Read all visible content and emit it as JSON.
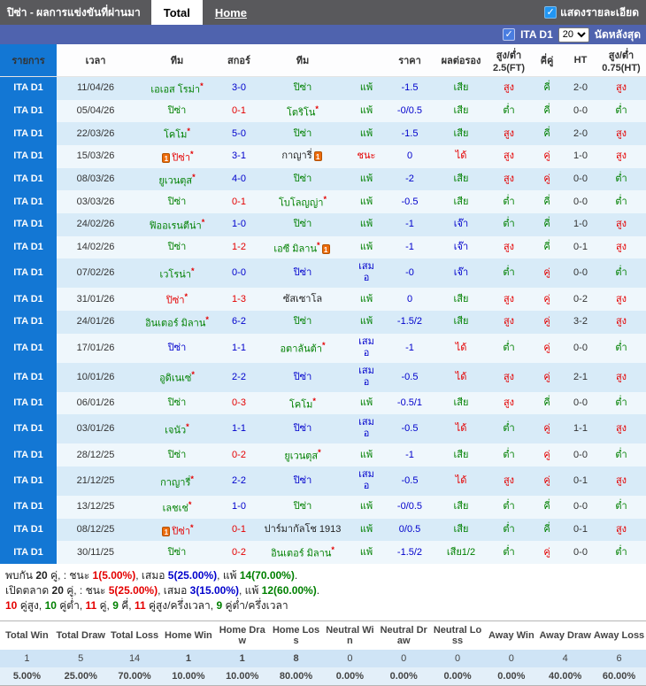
{
  "topbar": {
    "title": "ปิซ่า - ผลการแข่งขันที่ผ่านมา",
    "tabs": [
      {
        "label": "Total",
        "active": true
      },
      {
        "label": "Home",
        "active": false
      }
    ],
    "detail_checkbox_label": "แสดงรายละเอียด",
    "checkbox_checked": "✓"
  },
  "filterbar": {
    "league_label": "ITA D1",
    "match_count": "20",
    "suffix_label": "นัดหลังสุด",
    "checkbox_checked": "✓"
  },
  "colors": {
    "accent_blue_bar": "#4f63ae",
    "league_badge": "#1377d4",
    "row_odd": "#d8ebf8",
    "row_even": "#eff7fc",
    "win_red": "#e40000",
    "lose_green": "#008000",
    "draw_blue": "#0000cc"
  },
  "value_color_map": {
    "สูง": "red",
    "ต่ำ": "green",
    "คี่": "green",
    "คู่": "red",
    "แพ้": "green",
    "ชนะ": "red",
    "เสมอ": "blue",
    "เสีย": "green",
    "เสีย1/2": "green",
    "ได้": "red",
    "เจ๊า": "blue"
  },
  "table": {
    "headers": [
      "รายการ",
      "เวลา",
      "ทีม",
      "สกอร์",
      "ทีม",
      "",
      "ราคา",
      "ผลต่อรอง",
      "สูง/ต่ำ 2.5(FT)",
      "คี่คู่",
      "HT",
      "สูง/ต่ำ 0.75(HT)"
    ],
    "rows": [
      {
        "league": "ITA D1",
        "date": "11/04/26",
        "home": {
          "n": "เอเอส โรม่า",
          "c": "green",
          "s": 1
        },
        "score": "3-0",
        "sc": "blue",
        "away": {
          "n": "ปิซ่า",
          "c": "green"
        },
        "result": "แพ้",
        "price": "-1.5",
        "hdp": "เสีย",
        "ou_ft": "สูง",
        "oe": "คี่",
        "ht": "2-0",
        "ou_ht": "สูง"
      },
      {
        "league": "ITA D1",
        "date": "05/04/26",
        "home": {
          "n": "ปิซ่า",
          "c": "green"
        },
        "score": "0-1",
        "sc": "red",
        "away": {
          "n": "โตริโน",
          "c": "green",
          "s": 1
        },
        "result": "แพ้",
        "price": "-0/0.5",
        "hdp": "เสีย",
        "ou_ft": "ต่ำ",
        "oe": "คี่",
        "ht": "0-0",
        "ou_ht": "ต่ำ"
      },
      {
        "league": "ITA D1",
        "date": "22/03/26",
        "home": {
          "n": "โคโม",
          "c": "green",
          "s": 1
        },
        "score": "5-0",
        "sc": "blue",
        "away": {
          "n": "ปิซ่า",
          "c": "green"
        },
        "result": "แพ้",
        "price": "-1.5",
        "hdp": "เสีย",
        "ou_ft": "สูง",
        "oe": "คี่",
        "ht": "2-0",
        "ou_ht": "สูง"
      },
      {
        "league": "ITA D1",
        "date": "15/03/26",
        "home": {
          "n": "ปิซ่า",
          "c": "red",
          "s": 1,
          "cd": 1
        },
        "score": "3-1",
        "sc": "blue",
        "away": {
          "n": "กาญารี่",
          "c": "black",
          "cd": 1
        },
        "result": "ชนะ",
        "price": "0",
        "hdp": "ได้",
        "ou_ft": "สูง",
        "oe": "คู่",
        "ht": "1-0",
        "ou_ht": "สูง"
      },
      {
        "league": "ITA D1",
        "date": "08/03/26",
        "home": {
          "n": "ยูเวนตุส",
          "c": "green",
          "s": 1
        },
        "score": "4-0",
        "sc": "blue",
        "away": {
          "n": "ปิซ่า",
          "c": "green"
        },
        "result": "แพ้",
        "price": "-2",
        "hdp": "เสีย",
        "ou_ft": "สูง",
        "oe": "คู่",
        "ht": "0-0",
        "ou_ht": "ต่ำ"
      },
      {
        "league": "ITA D1",
        "date": "03/03/26",
        "home": {
          "n": "ปิซ่า",
          "c": "green"
        },
        "score": "0-1",
        "sc": "red",
        "away": {
          "n": "โบโลญญ่า",
          "c": "green",
          "s": 1
        },
        "result": "แพ้",
        "price": "-0.5",
        "hdp": "เสีย",
        "ou_ft": "ต่ำ",
        "oe": "คี่",
        "ht": "0-0",
        "ou_ht": "ต่ำ"
      },
      {
        "league": "ITA D1",
        "date": "24/02/26",
        "home": {
          "n": "ฟิออเรนตีน่า",
          "c": "green",
          "s": 1
        },
        "score": "1-0",
        "sc": "blue",
        "away": {
          "n": "ปิซ่า",
          "c": "green"
        },
        "result": "แพ้",
        "price": "-1",
        "hdp": "เจ๊า",
        "ou_ft": "ต่ำ",
        "oe": "คี่",
        "ht": "1-0",
        "ou_ht": "สูง"
      },
      {
        "league": "ITA D1",
        "date": "14/02/26",
        "home": {
          "n": "ปิซ่า",
          "c": "green"
        },
        "score": "1-2",
        "sc": "red",
        "away": {
          "n": "เอซี มิลาน",
          "c": "green",
          "s": 1,
          "cd": 1
        },
        "result": "แพ้",
        "price": "-1",
        "hdp": "เจ๊า",
        "ou_ft": "สูง",
        "oe": "คี่",
        "ht": "0-1",
        "ou_ht": "สูง"
      },
      {
        "league": "ITA D1",
        "date": "07/02/26",
        "home": {
          "n": "เวโรน่า",
          "c": "green",
          "s": 1
        },
        "score": "0-0",
        "sc": "blue",
        "away": {
          "n": "ปิซ่า",
          "c": "blue"
        },
        "result": "เสมอ",
        "price": "-0",
        "hdp": "เจ๊า",
        "ou_ft": "ต่ำ",
        "oe": "คู่",
        "ht": "0-0",
        "ou_ht": "ต่ำ"
      },
      {
        "league": "ITA D1",
        "date": "31/01/26",
        "home": {
          "n": "ปิซ่า",
          "c": "red",
          "s": 1
        },
        "score": "1-3",
        "sc": "red",
        "away": {
          "n": "ซัสเซาโล",
          "c": "black"
        },
        "result": "แพ้",
        "price": "0",
        "hdp": "เสีย",
        "ou_ft": "สูง",
        "oe": "คู่",
        "ht": "0-2",
        "ou_ht": "สูง"
      },
      {
        "league": "ITA D1",
        "date": "24/01/26",
        "home": {
          "n": "อินเตอร์ มิลาน",
          "c": "green",
          "s": 1
        },
        "score": "6-2",
        "sc": "blue",
        "away": {
          "n": "ปิซ่า",
          "c": "green"
        },
        "result": "แพ้",
        "price": "-1.5/2",
        "hdp": "เสีย",
        "ou_ft": "สูง",
        "oe": "คู่",
        "ht": "3-2",
        "ou_ht": "สูง"
      },
      {
        "league": "ITA D1",
        "date": "17/01/26",
        "home": {
          "n": "ปิซ่า",
          "c": "blue"
        },
        "score": "1-1",
        "sc": "blue",
        "away": {
          "n": "อตาลันต้า",
          "c": "green",
          "s": 1
        },
        "result": "เสมอ",
        "price": "-1",
        "hdp": "ได้",
        "ou_ft": "ต่ำ",
        "oe": "คู่",
        "ht": "0-0",
        "ou_ht": "ต่ำ"
      },
      {
        "league": "ITA D1",
        "date": "10/01/26",
        "home": {
          "n": "อูดิเนเซ่",
          "c": "green",
          "s": 1
        },
        "score": "2-2",
        "sc": "blue",
        "away": {
          "n": "ปิซ่า",
          "c": "blue"
        },
        "result": "เสมอ",
        "price": "-0.5",
        "hdp": "ได้",
        "ou_ft": "สูง",
        "oe": "คู่",
        "ht": "2-1",
        "ou_ht": "สูง"
      },
      {
        "league": "ITA D1",
        "date": "06/01/26",
        "home": {
          "n": "ปิซ่า",
          "c": "green"
        },
        "score": "0-3",
        "sc": "red",
        "away": {
          "n": "โคโม",
          "c": "green",
          "s": 1
        },
        "result": "แพ้",
        "price": "-0.5/1",
        "hdp": "เสีย",
        "ou_ft": "สูง",
        "oe": "คี่",
        "ht": "0-0",
        "ou_ht": "ต่ำ"
      },
      {
        "league": "ITA D1",
        "date": "03/01/26",
        "home": {
          "n": "เจนัว",
          "c": "green",
          "s": 1
        },
        "score": "1-1",
        "sc": "blue",
        "away": {
          "n": "ปิซ่า",
          "c": "blue"
        },
        "result": "เสมอ",
        "price": "-0.5",
        "hdp": "ได้",
        "ou_ft": "ต่ำ",
        "oe": "คู่",
        "ht": "1-1",
        "ou_ht": "สูง"
      },
      {
        "league": "ITA D1",
        "date": "28/12/25",
        "home": {
          "n": "ปิซ่า",
          "c": "green"
        },
        "score": "0-2",
        "sc": "red",
        "away": {
          "n": "ยูเวนตุส",
          "c": "green",
          "s": 1
        },
        "result": "แพ้",
        "price": "-1",
        "hdp": "เสีย",
        "ou_ft": "ต่ำ",
        "oe": "คู่",
        "ht": "0-0",
        "ou_ht": "ต่ำ"
      },
      {
        "league": "ITA D1",
        "date": "21/12/25",
        "home": {
          "n": "กาญารี่",
          "c": "green",
          "s": 1
        },
        "score": "2-2",
        "sc": "blue",
        "away": {
          "n": "ปิซ่า",
          "c": "blue"
        },
        "result": "เสมอ",
        "price": "-0.5",
        "hdp": "ได้",
        "ou_ft": "สูง",
        "oe": "คู่",
        "ht": "0-1",
        "ou_ht": "สูง"
      },
      {
        "league": "ITA D1",
        "date": "13/12/25",
        "home": {
          "n": "เลชเช่",
          "c": "green",
          "s": 1
        },
        "score": "1-0",
        "sc": "blue",
        "away": {
          "n": "ปิซ่า",
          "c": "green"
        },
        "result": "แพ้",
        "price": "-0/0.5",
        "hdp": "เสีย",
        "ou_ft": "ต่ำ",
        "oe": "คี่",
        "ht": "0-0",
        "ou_ht": "ต่ำ"
      },
      {
        "league": "ITA D1",
        "date": "08/12/25",
        "home": {
          "n": "ปิซ่า",
          "c": "red",
          "s": 1,
          "cd": 1
        },
        "score": "0-1",
        "sc": "red",
        "away": {
          "n": "ปาร์มากัลโช 1913",
          "c": "black"
        },
        "result": "แพ้",
        "price": "0/0.5",
        "hdp": "เสีย",
        "ou_ft": "ต่ำ",
        "oe": "คี่",
        "ht": "0-1",
        "ou_ht": "สูง"
      },
      {
        "league": "ITA D1",
        "date": "30/11/25",
        "home": {
          "n": "ปิซ่า",
          "c": "green"
        },
        "score": "0-2",
        "sc": "red",
        "away": {
          "n": "อินเตอร์ มิลาน",
          "c": "green",
          "s": 1
        },
        "result": "แพ้",
        "price": "-1.5/2",
        "hdp": "เสีย1/2",
        "ou_ft": "ต่ำ",
        "oe": "คู่",
        "ht": "0-0",
        "ou_ht": "ต่ำ"
      }
    ]
  },
  "summary": {
    "lines": [
      [
        {
          "t": "พบกัน ",
          "c": "k"
        },
        {
          "t": "20",
          "c": "k",
          "b": 1
        },
        {
          "t": " คู่, : ชนะ ",
          "c": "k"
        },
        {
          "t": "1(5.00%)",
          "c": "red",
          "b": 1
        },
        {
          "t": ", เสมอ ",
          "c": "k"
        },
        {
          "t": "5(25.00%)",
          "c": "blue",
          "b": 1
        },
        {
          "t": ", แพ้ ",
          "c": "k"
        },
        {
          "t": "14(70.00%)",
          "c": "green",
          "b": 1
        },
        {
          "t": ".",
          "c": "k"
        }
      ],
      [
        {
          "t": "เปิดตลาด ",
          "c": "k"
        },
        {
          "t": "20",
          "c": "k",
          "b": 1
        },
        {
          "t": " คู่, : ชนะ ",
          "c": "k"
        },
        {
          "t": "5(25.00%)",
          "c": "red",
          "b": 1
        },
        {
          "t": ", เสมอ ",
          "c": "k"
        },
        {
          "t": "3(15.00%)",
          "c": "blue",
          "b": 1
        },
        {
          "t": ", แพ้ ",
          "c": "k"
        },
        {
          "t": "12(60.00%)",
          "c": "green",
          "b": 1
        },
        {
          "t": ".",
          "c": "k"
        }
      ],
      [
        {
          "t": "10",
          "c": "red",
          "b": 1
        },
        {
          "t": " คู่สูง, ",
          "c": "k"
        },
        {
          "t": "10",
          "c": "green",
          "b": 1
        },
        {
          "t": " คู่ต่ำ, ",
          "c": "k"
        },
        {
          "t": "11",
          "c": "red",
          "b": 1
        },
        {
          "t": " คู่, ",
          "c": "k"
        },
        {
          "t": "9",
          "c": "green",
          "b": 1
        },
        {
          "t": " คี่, ",
          "c": "k"
        },
        {
          "t": "11",
          "c": "red",
          "b": 1
        },
        {
          "t": " คู่สูง/ครึ่งเวลา, ",
          "c": "k"
        },
        {
          "t": "9",
          "c": "green",
          "b": 1
        },
        {
          "t": " คู่ต่ำ/ครึ่งเวลา",
          "c": "k"
        }
      ]
    ]
  },
  "stats": {
    "columns": [
      {
        "label": "Total Win",
        "count": "1",
        "pct": "5.00%",
        "highlight": false
      },
      {
        "label": "Total Draw",
        "count": "5",
        "pct": "25.00%",
        "highlight": false
      },
      {
        "label": "Total Loss",
        "count": "14",
        "pct": "70.00%",
        "highlight": false
      },
      {
        "label": "Home Win",
        "count": "1",
        "pct": "10.00%",
        "highlight": true
      },
      {
        "label": "Home Draw",
        "count": "1",
        "pct": "10.00%",
        "highlight": true
      },
      {
        "label": "Home Loss",
        "count": "8",
        "pct": "80.00%",
        "highlight": true
      },
      {
        "label": "Neutral Win",
        "count": "0",
        "pct": "0.00%",
        "highlight": false
      },
      {
        "label": "Neutral Draw",
        "count": "0",
        "pct": "0.00%",
        "highlight": false
      },
      {
        "label": "Neutral Loss",
        "count": "0",
        "pct": "0.00%",
        "highlight": false
      },
      {
        "label": "Away Win",
        "count": "0",
        "pct": "0.00%",
        "highlight": false
      },
      {
        "label": "Away Draw",
        "count": "4",
        "pct": "40.00%",
        "highlight": false
      },
      {
        "label": "Away Loss",
        "count": "6",
        "pct": "60.00%",
        "highlight": false
      }
    ]
  }
}
